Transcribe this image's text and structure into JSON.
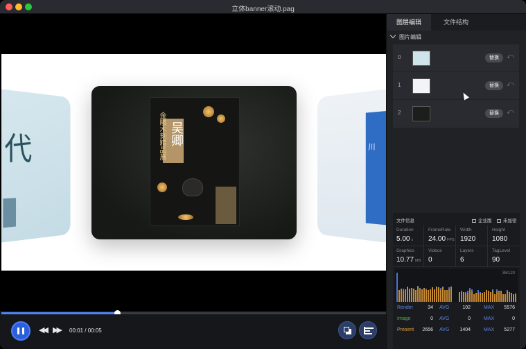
{
  "window": {
    "title": "立体banner滚动.pag"
  },
  "preview": {
    "left_card": {
      "glyph": "代"
    },
    "poster": {
      "vertical_text": "金雕木刻精品展",
      "title": "吴卿"
    },
    "right_card": {
      "text": "川"
    }
  },
  "playback": {
    "progress": 0.3,
    "time": "00:01 / 00:05"
  },
  "panel": {
    "tabs": [
      {
        "label": "图层编辑",
        "active": true
      },
      {
        "label": "文件结构",
        "active": false
      }
    ],
    "section_title": "图片编辑",
    "layers": [
      {
        "index": "0",
        "button": "替换",
        "thumb_color": "#cfe4ea"
      },
      {
        "index": "1",
        "button": "替换",
        "thumb_color": "#f2f4f8"
      },
      {
        "index": "2",
        "button": "替换",
        "thumb_color": "#1d1e1b"
      }
    ],
    "file_info": {
      "title": "文件信息",
      "enterprise_btn": "企业版",
      "encrypt_btn": "未加密",
      "stats": [
        {
          "label": "Duration",
          "value": "5.00",
          "unit": "s"
        },
        {
          "label": "FrameRate",
          "value": "24.00",
          "unit": "FPS"
        },
        {
          "label": "Width",
          "value": "1920",
          "unit": ""
        },
        {
          "label": "Height",
          "value": "1080",
          "unit": ""
        },
        {
          "label": "Graphics",
          "value": "10.77",
          "unit": "MB"
        },
        {
          "label": "Videos",
          "value": "0",
          "unit": ""
        },
        {
          "label": "Layers",
          "value": "6",
          "unit": ""
        },
        {
          "label": "TagLevel",
          "value": "90",
          "unit": ""
        }
      ],
      "frame_counter": "36/120",
      "perf": [
        {
          "label": "Render",
          "color": "#5b86e6",
          "value": "34",
          "avg_label": "AVG",
          "avg": "102",
          "max_label": "MAX",
          "max": "5576"
        },
        {
          "label": "Image",
          "color": "#4caf50",
          "value": "0",
          "avg_label": "AVG",
          "avg": "0",
          "max_label": "MAX",
          "max": "0"
        },
        {
          "label": "Present",
          "color": "#e6a23c",
          "value": "2656",
          "avg_label": "AVG",
          "avg": "1404",
          "max_label": "MAX",
          "max": "5277"
        }
      ]
    }
  }
}
